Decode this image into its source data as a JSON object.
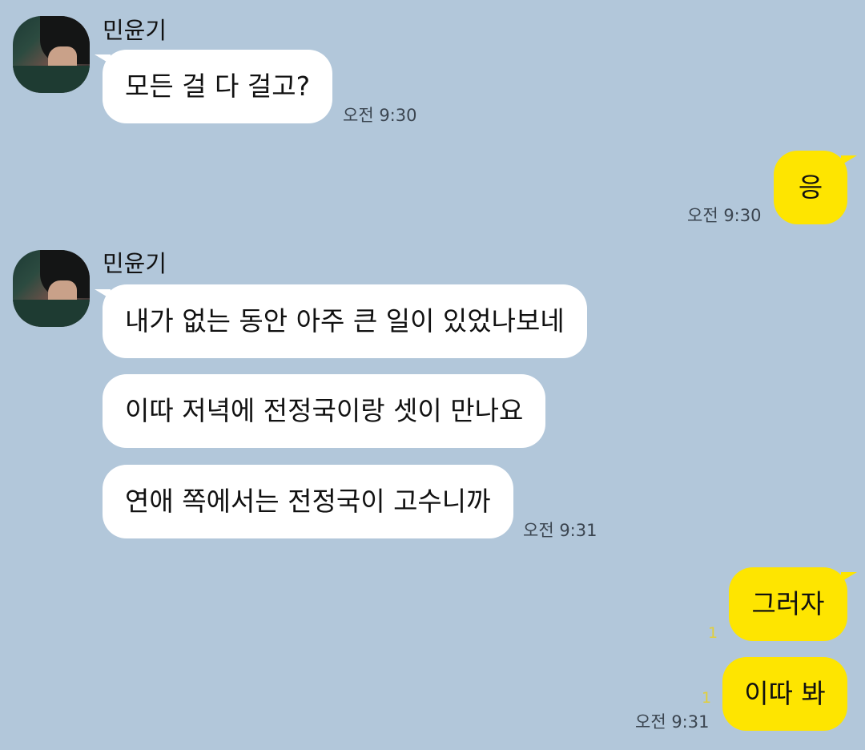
{
  "sender_name": "민윤기",
  "messages": {
    "m1": "모든 걸 다 걸고?",
    "m2": "응",
    "m3": "내가 없는 동안 아주 큰 일이 있었나보네",
    "m4": "이따 저녁에 전정국이랑 셋이 만나요",
    "m5": "연애 쪽에서는 전정국이 고수니까",
    "m6": "그러자",
    "m7": "이따 봐"
  },
  "times": {
    "t1": "오전 9:30",
    "t2": "오전 9:30",
    "t3": "오전 9:31",
    "t4": "오전 9:31"
  },
  "unread": {
    "u1": "1",
    "u2": "1"
  },
  "colors": {
    "background": "#b2c7da",
    "my_bubble": "#fee500",
    "other_bubble": "#ffffff",
    "unread_count": "#e2cf3a"
  }
}
